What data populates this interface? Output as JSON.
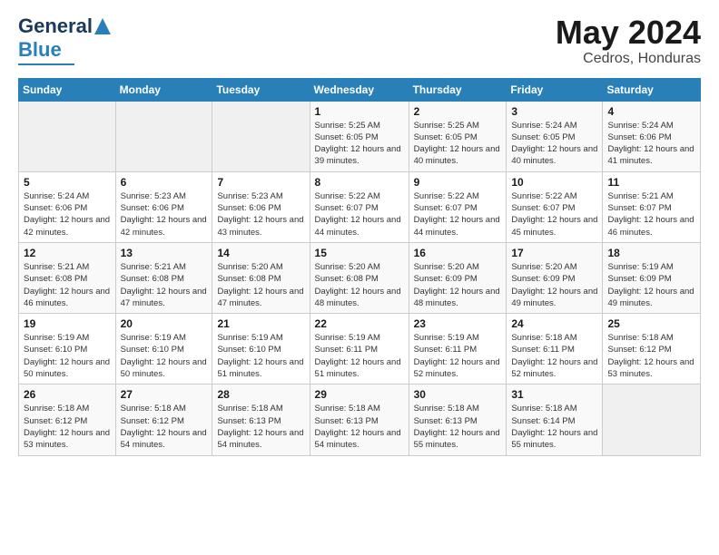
{
  "header": {
    "logo_line1": "General",
    "logo_line2": "Blue",
    "month_year": "May 2024",
    "location": "Cedros, Honduras"
  },
  "weekdays": [
    "Sunday",
    "Monday",
    "Tuesday",
    "Wednesday",
    "Thursday",
    "Friday",
    "Saturday"
  ],
  "weeks": [
    [
      {
        "day": "",
        "sunrise": "",
        "sunset": "",
        "daylight": ""
      },
      {
        "day": "",
        "sunrise": "",
        "sunset": "",
        "daylight": ""
      },
      {
        "day": "",
        "sunrise": "",
        "sunset": "",
        "daylight": ""
      },
      {
        "day": "1",
        "sunrise": "Sunrise: 5:25 AM",
        "sunset": "Sunset: 6:05 PM",
        "daylight": "Daylight: 12 hours and 39 minutes."
      },
      {
        "day": "2",
        "sunrise": "Sunrise: 5:25 AM",
        "sunset": "Sunset: 6:05 PM",
        "daylight": "Daylight: 12 hours and 40 minutes."
      },
      {
        "day": "3",
        "sunrise": "Sunrise: 5:24 AM",
        "sunset": "Sunset: 6:05 PM",
        "daylight": "Daylight: 12 hours and 40 minutes."
      },
      {
        "day": "4",
        "sunrise": "Sunrise: 5:24 AM",
        "sunset": "Sunset: 6:06 PM",
        "daylight": "Daylight: 12 hours and 41 minutes."
      }
    ],
    [
      {
        "day": "5",
        "sunrise": "Sunrise: 5:24 AM",
        "sunset": "Sunset: 6:06 PM",
        "daylight": "Daylight: 12 hours and 42 minutes."
      },
      {
        "day": "6",
        "sunrise": "Sunrise: 5:23 AM",
        "sunset": "Sunset: 6:06 PM",
        "daylight": "Daylight: 12 hours and 42 minutes."
      },
      {
        "day": "7",
        "sunrise": "Sunrise: 5:23 AM",
        "sunset": "Sunset: 6:06 PM",
        "daylight": "Daylight: 12 hours and 43 minutes."
      },
      {
        "day": "8",
        "sunrise": "Sunrise: 5:22 AM",
        "sunset": "Sunset: 6:07 PM",
        "daylight": "Daylight: 12 hours and 44 minutes."
      },
      {
        "day": "9",
        "sunrise": "Sunrise: 5:22 AM",
        "sunset": "Sunset: 6:07 PM",
        "daylight": "Daylight: 12 hours and 44 minutes."
      },
      {
        "day": "10",
        "sunrise": "Sunrise: 5:22 AM",
        "sunset": "Sunset: 6:07 PM",
        "daylight": "Daylight: 12 hours and 45 minutes."
      },
      {
        "day": "11",
        "sunrise": "Sunrise: 5:21 AM",
        "sunset": "Sunset: 6:07 PM",
        "daylight": "Daylight: 12 hours and 46 minutes."
      }
    ],
    [
      {
        "day": "12",
        "sunrise": "Sunrise: 5:21 AM",
        "sunset": "Sunset: 6:08 PM",
        "daylight": "Daylight: 12 hours and 46 minutes."
      },
      {
        "day": "13",
        "sunrise": "Sunrise: 5:21 AM",
        "sunset": "Sunset: 6:08 PM",
        "daylight": "Daylight: 12 hours and 47 minutes."
      },
      {
        "day": "14",
        "sunrise": "Sunrise: 5:20 AM",
        "sunset": "Sunset: 6:08 PM",
        "daylight": "Daylight: 12 hours and 47 minutes."
      },
      {
        "day": "15",
        "sunrise": "Sunrise: 5:20 AM",
        "sunset": "Sunset: 6:08 PM",
        "daylight": "Daylight: 12 hours and 48 minutes."
      },
      {
        "day": "16",
        "sunrise": "Sunrise: 5:20 AM",
        "sunset": "Sunset: 6:09 PM",
        "daylight": "Daylight: 12 hours and 48 minutes."
      },
      {
        "day": "17",
        "sunrise": "Sunrise: 5:20 AM",
        "sunset": "Sunset: 6:09 PM",
        "daylight": "Daylight: 12 hours and 49 minutes."
      },
      {
        "day": "18",
        "sunrise": "Sunrise: 5:19 AM",
        "sunset": "Sunset: 6:09 PM",
        "daylight": "Daylight: 12 hours and 49 minutes."
      }
    ],
    [
      {
        "day": "19",
        "sunrise": "Sunrise: 5:19 AM",
        "sunset": "Sunset: 6:10 PM",
        "daylight": "Daylight: 12 hours and 50 minutes."
      },
      {
        "day": "20",
        "sunrise": "Sunrise: 5:19 AM",
        "sunset": "Sunset: 6:10 PM",
        "daylight": "Daylight: 12 hours and 50 minutes."
      },
      {
        "day": "21",
        "sunrise": "Sunrise: 5:19 AM",
        "sunset": "Sunset: 6:10 PM",
        "daylight": "Daylight: 12 hours and 51 minutes."
      },
      {
        "day": "22",
        "sunrise": "Sunrise: 5:19 AM",
        "sunset": "Sunset: 6:11 PM",
        "daylight": "Daylight: 12 hours and 51 minutes."
      },
      {
        "day": "23",
        "sunrise": "Sunrise: 5:19 AM",
        "sunset": "Sunset: 6:11 PM",
        "daylight": "Daylight: 12 hours and 52 minutes."
      },
      {
        "day": "24",
        "sunrise": "Sunrise: 5:18 AM",
        "sunset": "Sunset: 6:11 PM",
        "daylight": "Daylight: 12 hours and 52 minutes."
      },
      {
        "day": "25",
        "sunrise": "Sunrise: 5:18 AM",
        "sunset": "Sunset: 6:12 PM",
        "daylight": "Daylight: 12 hours and 53 minutes."
      }
    ],
    [
      {
        "day": "26",
        "sunrise": "Sunrise: 5:18 AM",
        "sunset": "Sunset: 6:12 PM",
        "daylight": "Daylight: 12 hours and 53 minutes."
      },
      {
        "day": "27",
        "sunrise": "Sunrise: 5:18 AM",
        "sunset": "Sunset: 6:12 PM",
        "daylight": "Daylight: 12 hours and 54 minutes."
      },
      {
        "day": "28",
        "sunrise": "Sunrise: 5:18 AM",
        "sunset": "Sunset: 6:13 PM",
        "daylight": "Daylight: 12 hours and 54 minutes."
      },
      {
        "day": "29",
        "sunrise": "Sunrise: 5:18 AM",
        "sunset": "Sunset: 6:13 PM",
        "daylight": "Daylight: 12 hours and 54 minutes."
      },
      {
        "day": "30",
        "sunrise": "Sunrise: 5:18 AM",
        "sunset": "Sunset: 6:13 PM",
        "daylight": "Daylight: 12 hours and 55 minutes."
      },
      {
        "day": "31",
        "sunrise": "Sunrise: 5:18 AM",
        "sunset": "Sunset: 6:14 PM",
        "daylight": "Daylight: 12 hours and 55 minutes."
      },
      {
        "day": "",
        "sunrise": "",
        "sunset": "",
        "daylight": ""
      }
    ]
  ]
}
